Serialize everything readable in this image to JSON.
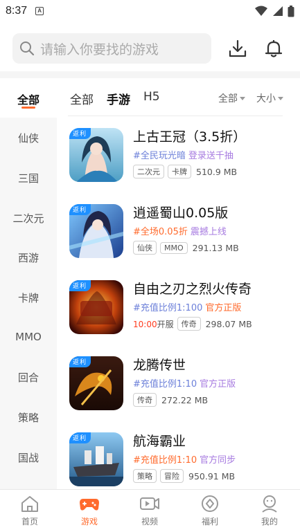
{
  "status_bar": {
    "time": "8:37",
    "a_badge": "A"
  },
  "search": {
    "placeholder": "请输入你要找的游戏"
  },
  "header": {
    "download_icon": "download-icon",
    "bell_icon": "bell-icon"
  },
  "sidebar": {
    "items": [
      {
        "label": "全部"
      },
      {
        "label": "仙侠"
      },
      {
        "label": "三国"
      },
      {
        "label": "二次元"
      },
      {
        "label": "西游"
      },
      {
        "label": "卡牌"
      },
      {
        "label": "MMO"
      },
      {
        "label": "回合"
      },
      {
        "label": "策略"
      },
      {
        "label": "国战"
      }
    ],
    "active_index": 0
  },
  "tabs": [
    {
      "label": "全部"
    },
    {
      "label": "手游"
    },
    {
      "label": "H5"
    }
  ],
  "active_tab": 1,
  "filters": [
    {
      "label": "全部"
    },
    {
      "label": "大小"
    }
  ],
  "rebate_label": "返利",
  "games": [
    {
      "title": "上古王冠（3.5折）",
      "promo_tag": "#全民玩光暗",
      "promo_tag_color": "blue",
      "promo_extra": "登录送千抽",
      "open_time": "",
      "open_suffix": "",
      "tags": [
        "二次元",
        "卡牌"
      ],
      "size": "510.9 MB"
    },
    {
      "title": "逍遥蜀山0.05版",
      "promo_tag": "#全场0.05折",
      "promo_tag_color": "orange",
      "promo_extra": "震撼上线",
      "open_time": "",
      "open_suffix": "",
      "tags": [
        "仙侠",
        "MMO"
      ],
      "size": "291.13 MB"
    },
    {
      "title": "自由之刃之烈火传奇",
      "promo_tag": "#充值比例1:100",
      "promo_tag_color": "blue",
      "promo_extra": "官方正版",
      "open_time": "10:00",
      "open_suffix": "开服",
      "tags": [
        "传奇"
      ],
      "size": "298.07 MB"
    },
    {
      "title": "龙腾传世",
      "promo_tag": "#充值比例1:10",
      "promo_tag_color": "blue",
      "promo_extra": "官方正版",
      "open_time": "",
      "open_suffix": "",
      "tags": [
        "传奇"
      ],
      "size": "272.22 MB"
    },
    {
      "title": "航海霸业",
      "promo_tag": "#充值比例1:10",
      "promo_tag_color": "orange",
      "promo_extra": "官方同步",
      "open_time": "",
      "open_suffix": "",
      "tags": [
        "策略",
        "冒险"
      ],
      "size": "950.91 MB"
    }
  ],
  "bottom_nav": [
    {
      "label": "首页",
      "icon": "home-icon"
    },
    {
      "label": "游戏",
      "icon": "gamepad-icon"
    },
    {
      "label": "视频",
      "icon": "video-icon"
    },
    {
      "label": "福利",
      "icon": "gift-icon"
    },
    {
      "label": "我的",
      "icon": "profile-icon"
    }
  ],
  "active_nav": 1,
  "colors": {
    "accent": "#ff6a2c",
    "rebate": "#1e90ff",
    "promo_blue": "#6b7fd9",
    "promo_orange": "#ff6a2c",
    "promo_purple": "#a77be0",
    "open_red": "#ff3b1d"
  }
}
